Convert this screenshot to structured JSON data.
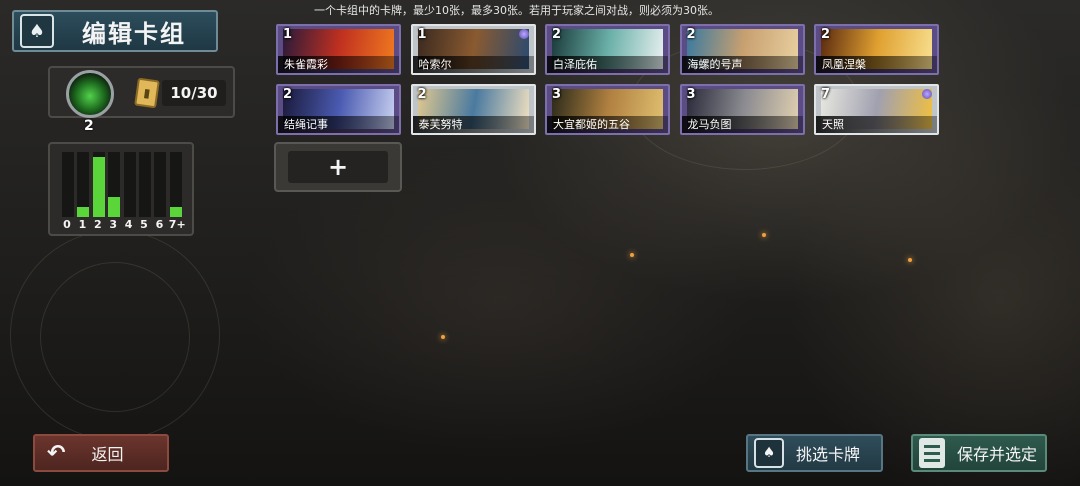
{
  "header": {
    "title": "编辑卡组",
    "hint": "一个卡组中的卡牌，最少10张，最多30张。若用于玩家之间对战，则必须为30张。"
  },
  "deck": {
    "count": "10/30",
    "leader_cost": "2"
  },
  "histogram": {
    "labels": [
      "0",
      "1",
      "2",
      "3",
      "4",
      "5",
      "6",
      "7+"
    ],
    "values": [
      0,
      1,
      6,
      2,
      0,
      0,
      0,
      1
    ],
    "bar_color": "#5ad63a"
  },
  "cards": [
    {
      "cost": "1",
      "name": "朱雀霞彩",
      "frame": "purple",
      "art": [
        "#2a1a3a",
        "#c03020",
        "#f07a20"
      ]
    },
    {
      "cost": "1",
      "name": "哈索尔",
      "frame": "silver",
      "art": [
        "#3a2a20",
        "#8a5a30",
        "#2a4a70"
      ]
    },
    {
      "cost": "2",
      "name": "白泽庇佑",
      "frame": "purple",
      "art": [
        "#1a3a3a",
        "#6ab0a8",
        "#e8f0f0"
      ]
    },
    {
      "cost": "2",
      "name": "海螺的号声",
      "frame": "purple",
      "art": [
        "#3a7aa0",
        "#c8a070",
        "#e8d0a0"
      ]
    },
    {
      "cost": "2",
      "name": "凤凰涅槃",
      "frame": "purple",
      "art": [
        "#5a2a10",
        "#e0a030",
        "#f8e090"
      ]
    },
    {
      "cost": "2",
      "name": "结绳记事",
      "frame": "purple",
      "art": [
        "#1a1a3a",
        "#4a5ab0",
        "#c8d0f0"
      ]
    },
    {
      "cost": "2",
      "name": "泰芙努特",
      "frame": "silver",
      "art": [
        "#e0c890",
        "#4a7aa0",
        "#f0e0c0"
      ]
    },
    {
      "cost": "3",
      "name": "大宜都姬的五谷",
      "frame": "purple",
      "art": [
        "#2a2a1a",
        "#b08040",
        "#e0c070"
      ]
    },
    {
      "cost": "3",
      "name": "龙马负图",
      "frame": "purple",
      "art": [
        "#2a2a3a",
        "#8a8a90",
        "#e0d0b0"
      ]
    },
    {
      "cost": "7",
      "name": "天照",
      "frame": "silver",
      "art": [
        "#e8e8e0",
        "#a0a0b0",
        "#f0c040"
      ]
    }
  ],
  "add_button": {
    "label": "+"
  },
  "buttons": {
    "back": "返回",
    "pick": "挑选卡牌",
    "save": "保存并选定"
  },
  "colors": {
    "title_bg": "#2d4d5c",
    "back_bg": "#6b352d",
    "save_bg": "#2f5a4e",
    "card_frame_purple": "#5c4c86"
  }
}
